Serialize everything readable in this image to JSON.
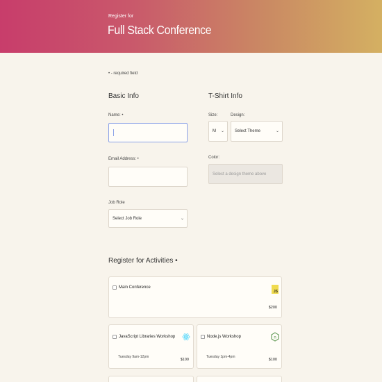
{
  "header": {
    "pretitle": "Register for",
    "title": "Full Stack Conference",
    "gradient_start": "#c83d6b",
    "gradient_end": "#d4b062"
  },
  "required_note": "• - required field",
  "basic_info": {
    "heading": "Basic Info",
    "name_label": "Name: •",
    "name_value": "",
    "email_label": "Email Address: •",
    "email_value": "",
    "job_role_label": "Job Role",
    "job_role_value": "Select Job Role"
  },
  "tshirt_info": {
    "heading": "T-Shirt Info",
    "size_label": "Size:",
    "size_value": "M",
    "design_label": "Design:",
    "design_value": "Select Theme",
    "color_label": "Color:",
    "color_value": "Select a design theme above"
  },
  "activities": {
    "heading": "Register for Activities •",
    "items": [
      {
        "title": "Main Conference",
        "time": "",
        "price": "$200",
        "icon": "js-icon",
        "checked": false
      },
      {
        "title": "JavaScript Libraries Workshop",
        "time": "Tuesday 9am-12pm",
        "price": "$100",
        "icon": "react-icon",
        "checked": false
      },
      {
        "title": "Node.js Workshop",
        "time": "Tuesday 1pm-4pm",
        "price": "$100",
        "icon": "node-icon",
        "checked": false
      }
    ]
  }
}
